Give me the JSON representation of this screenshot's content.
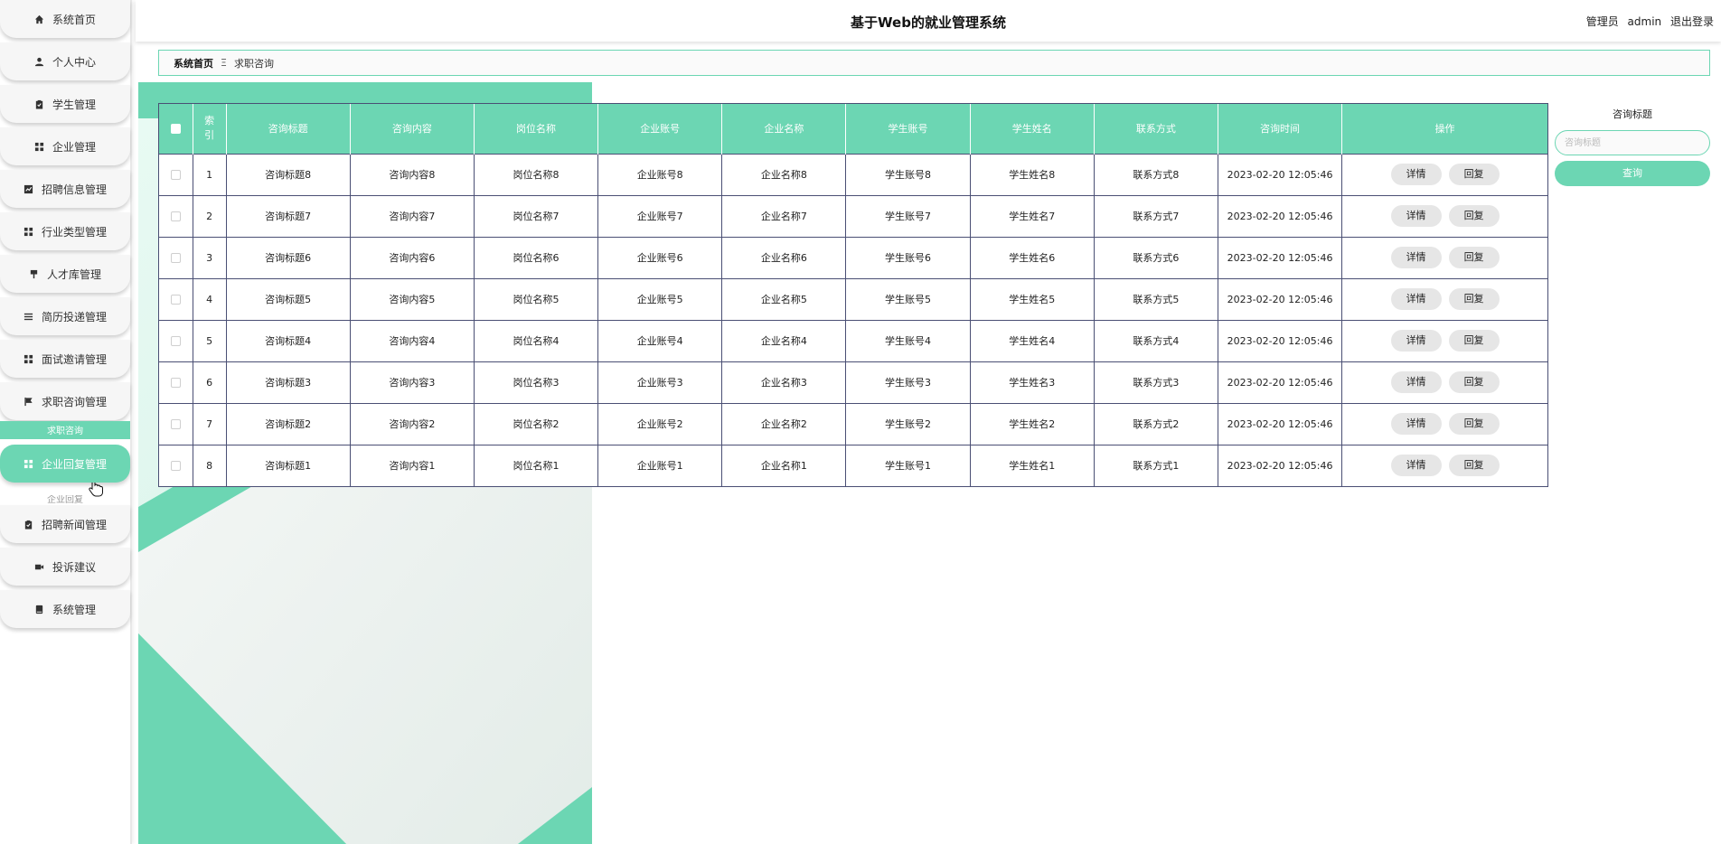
{
  "header": {
    "title": "基于Web的就业管理系统",
    "user_role": "管理员",
    "user_name": "admin",
    "logout_label": "退出登录"
  },
  "sidebar": {
    "items": [
      {
        "label": "系统首页",
        "icon": "home-icon"
      },
      {
        "label": "个人中心",
        "icon": "person-icon"
      },
      {
        "label": "学生管理",
        "icon": "clipboard-icon"
      },
      {
        "label": "企业管理",
        "icon": "grid-icon"
      },
      {
        "label": "招聘信息管理",
        "icon": "chart-icon"
      },
      {
        "label": "行业类型管理",
        "icon": "grid-icon"
      },
      {
        "label": "人才库管理",
        "icon": "pin-icon"
      },
      {
        "label": "简历投递管理",
        "icon": "list-icon"
      },
      {
        "label": "面试邀请管理",
        "icon": "grid-icon"
      },
      {
        "label": "求职咨询管理",
        "icon": "flag-icon"
      },
      {
        "label": "企业回复管理",
        "icon": "grid-icon"
      },
      {
        "label": "招聘新闻管理",
        "icon": "clipboard-icon"
      },
      {
        "label": "投诉建议",
        "icon": "video-icon"
      },
      {
        "label": "系统管理",
        "icon": "book-icon"
      }
    ],
    "active_index": 10,
    "peek_above": "求职咨询",
    "peek_below": "企业回复"
  },
  "breadcrumb": {
    "home": "系统首页",
    "separator": "Ξ",
    "current": "求职咨询"
  },
  "table": {
    "columns": [
      "索引",
      "咨询标题",
      "咨询内容",
      "岗位名称",
      "企业账号",
      "企业名称",
      "学生账号",
      "学生姓名",
      "联系方式",
      "咨询时间",
      "操作"
    ],
    "rows": [
      [
        "1",
        "咨询标题8",
        "咨询内容8",
        "岗位名称8",
        "企业账号8",
        "企业名称8",
        "学生账号8",
        "学生姓名8",
        "联系方式8",
        "2023-02-20 12:05:46"
      ],
      [
        "2",
        "咨询标题7",
        "咨询内容7",
        "岗位名称7",
        "企业账号7",
        "企业名称7",
        "学生账号7",
        "学生姓名7",
        "联系方式7",
        "2023-02-20 12:05:46"
      ],
      [
        "3",
        "咨询标题6",
        "咨询内容6",
        "岗位名称6",
        "企业账号6",
        "企业名称6",
        "学生账号6",
        "学生姓名6",
        "联系方式6",
        "2023-02-20 12:05:46"
      ],
      [
        "4",
        "咨询标题5",
        "咨询内容5",
        "岗位名称5",
        "企业账号5",
        "企业名称5",
        "学生账号5",
        "学生姓名5",
        "联系方式5",
        "2023-02-20 12:05:46"
      ],
      [
        "5",
        "咨询标题4",
        "咨询内容4",
        "岗位名称4",
        "企业账号4",
        "企业名称4",
        "学生账号4",
        "学生姓名4",
        "联系方式4",
        "2023-02-20 12:05:46"
      ],
      [
        "6",
        "咨询标题3",
        "咨询内容3",
        "岗位名称3",
        "企业账号3",
        "企业名称3",
        "学生账号3",
        "学生姓名3",
        "联系方式3",
        "2023-02-20 12:05:46"
      ],
      [
        "7",
        "咨询标题2",
        "咨询内容2",
        "岗位名称2",
        "企业账号2",
        "企业名称2",
        "学生账号2",
        "学生姓名2",
        "联系方式2",
        "2023-02-20 12:05:46"
      ],
      [
        "8",
        "咨询标题1",
        "咨询内容1",
        "岗位名称1",
        "企业账号1",
        "企业名称1",
        "学生账号1",
        "学生姓名1",
        "联系方式1",
        "2023-02-20 12:05:46"
      ]
    ],
    "actions": [
      "详情",
      "回复"
    ]
  },
  "search": {
    "label": "咨询标题",
    "placeholder": "咨询标题",
    "value": "",
    "button_label": "查询"
  },
  "colors": {
    "accent": "#6cd6b3",
    "table_border": "#4a4f74"
  }
}
